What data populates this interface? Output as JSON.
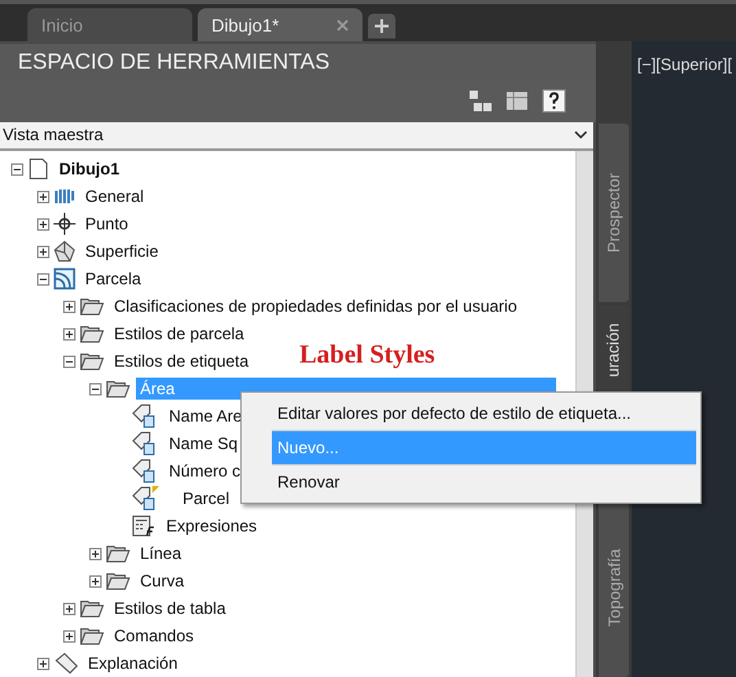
{
  "doc_tabs": [
    {
      "label": "Inicio",
      "selected": false,
      "closable": false
    },
    {
      "label": "Dibujo1*",
      "selected": true,
      "closable": true
    }
  ],
  "panel": {
    "title": "ESPACIO DE HERRAMIENTAS",
    "view_select": {
      "value": "Vista maestra"
    },
    "tree": [
      {
        "label": "Dibujo1",
        "kind": "drawing",
        "bold": true,
        "expanded": true,
        "selected": false,
        "children": [
          {
            "label": "General",
            "kind": "general",
            "expanded": false,
            "selected": false
          },
          {
            "label": "Punto",
            "kind": "point",
            "expanded": false,
            "selected": false
          },
          {
            "label": "Superficie",
            "kind": "surface",
            "expanded": false,
            "selected": false
          },
          {
            "label": "Parcela",
            "kind": "parcel",
            "expanded": true,
            "selected": false,
            "children": [
              {
                "label": "Clasificaciones de propiedades definidas por el usuario",
                "kind": "folder",
                "expanded": false,
                "selected": false
              },
              {
                "label": "Estilos de parcela",
                "kind": "folder",
                "expanded": false,
                "selected": false
              },
              {
                "label": "Estilos de etiqueta",
                "kind": "folder",
                "expanded": true,
                "selected": false,
                "children": [
                  {
                    "label": "Área",
                    "kind": "folder",
                    "expanded": true,
                    "selected": true,
                    "children": [
                      {
                        "label": "Name Are",
                        "kind": "label-style",
                        "selected": false
                      },
                      {
                        "label": "Name Sq",
                        "kind": "label-style",
                        "selected": false
                      },
                      {
                        "label": "Número c",
                        "kind": "label-style",
                        "selected": false
                      },
                      {
                        "label": "Parcel",
                        "kind": "label-style",
                        "flagged": true,
                        "selected": false
                      },
                      {
                        "label": "Expresiones",
                        "kind": "expressions",
                        "selected": false
                      }
                    ]
                  },
                  {
                    "label": "Línea",
                    "kind": "folder",
                    "expanded": false,
                    "selected": false
                  },
                  {
                    "label": "Curva",
                    "kind": "folder",
                    "expanded": false,
                    "selected": false
                  }
                ]
              },
              {
                "label": "Estilos de tabla",
                "kind": "folder",
                "expanded": false,
                "selected": false
              },
              {
                "label": "Comandos",
                "kind": "folder",
                "expanded": false,
                "selected": false
              }
            ]
          },
          {
            "label": "Explanación",
            "kind": "grading",
            "expanded": false,
            "selected": false
          }
        ]
      }
    ],
    "side_tabs": [
      {
        "label": "Prospector",
        "selected": false
      },
      {
        "label": "uración",
        "selected": true
      },
      {
        "label": "Topografía",
        "selected": false
      }
    ]
  },
  "viewport": {
    "label": "[−][Superior]["
  },
  "annotation": "Label Styles",
  "context_menu": [
    {
      "label": "Editar valores por defecto de estilo de etiqueta...",
      "selected": false
    },
    {
      "label": "Nuevo...",
      "selected": true
    },
    {
      "label": "Renovar",
      "selected": false
    }
  ]
}
